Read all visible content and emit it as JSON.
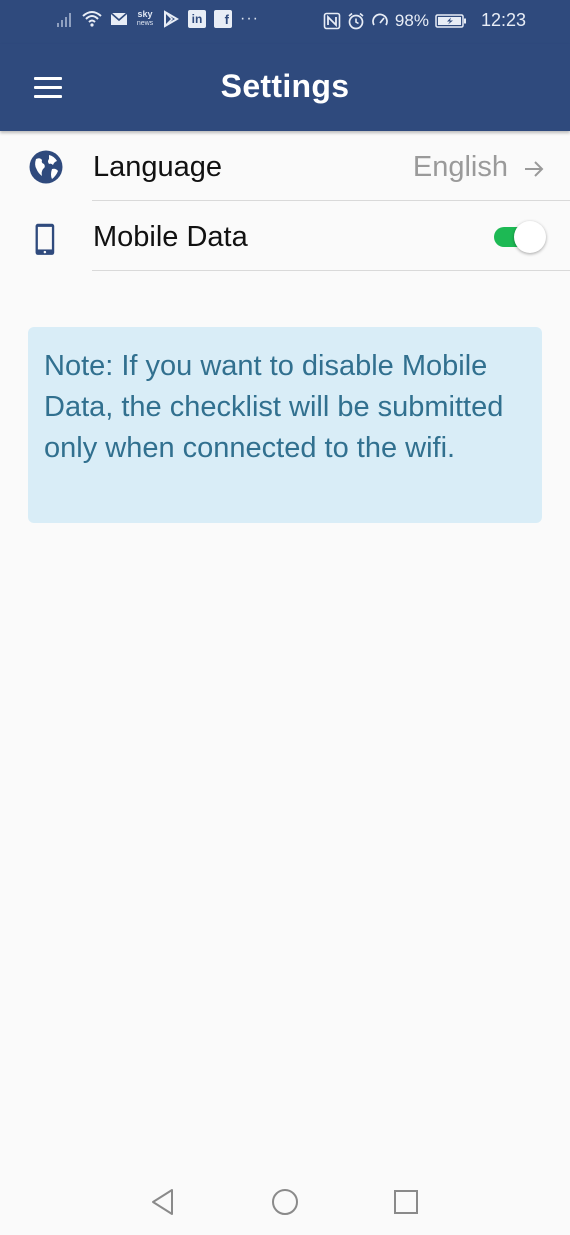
{
  "status_bar": {
    "sky_label": "sky",
    "sky_sub": "news",
    "linkedin_label": "in",
    "facebook_label": "f",
    "more_label": "···",
    "battery_percent": "98%",
    "time": "12:23",
    "icons": [
      "signal-icon",
      "wifi-icon",
      "mail-icon",
      "sky-news-icon",
      "play-store-icon",
      "linkedin-icon",
      "facebook-icon",
      "nfc-icon",
      "alarm-icon",
      "data-saver-icon",
      "battery-icon"
    ]
  },
  "app_bar": {
    "title": "Settings",
    "menu_icon": "hamburger-menu-icon",
    "color": "#2f4a7d"
  },
  "settings": {
    "language": {
      "label": "Language",
      "value": "English",
      "icon": "globe-icon"
    },
    "mobile_data": {
      "label": "Mobile Data",
      "icon": "smartphone-icon",
      "enabled": true,
      "toggle_color": "#1db954"
    }
  },
  "note": {
    "text": "Note: If you want to disable Mobile Data, the checklist will be submitted only when connected to the wifi.",
    "background": "#d9edf7",
    "color": "#31708f"
  },
  "nav_bar": {
    "icons": [
      "back-triangle-icon",
      "home-circle-icon",
      "recents-square-icon"
    ]
  }
}
